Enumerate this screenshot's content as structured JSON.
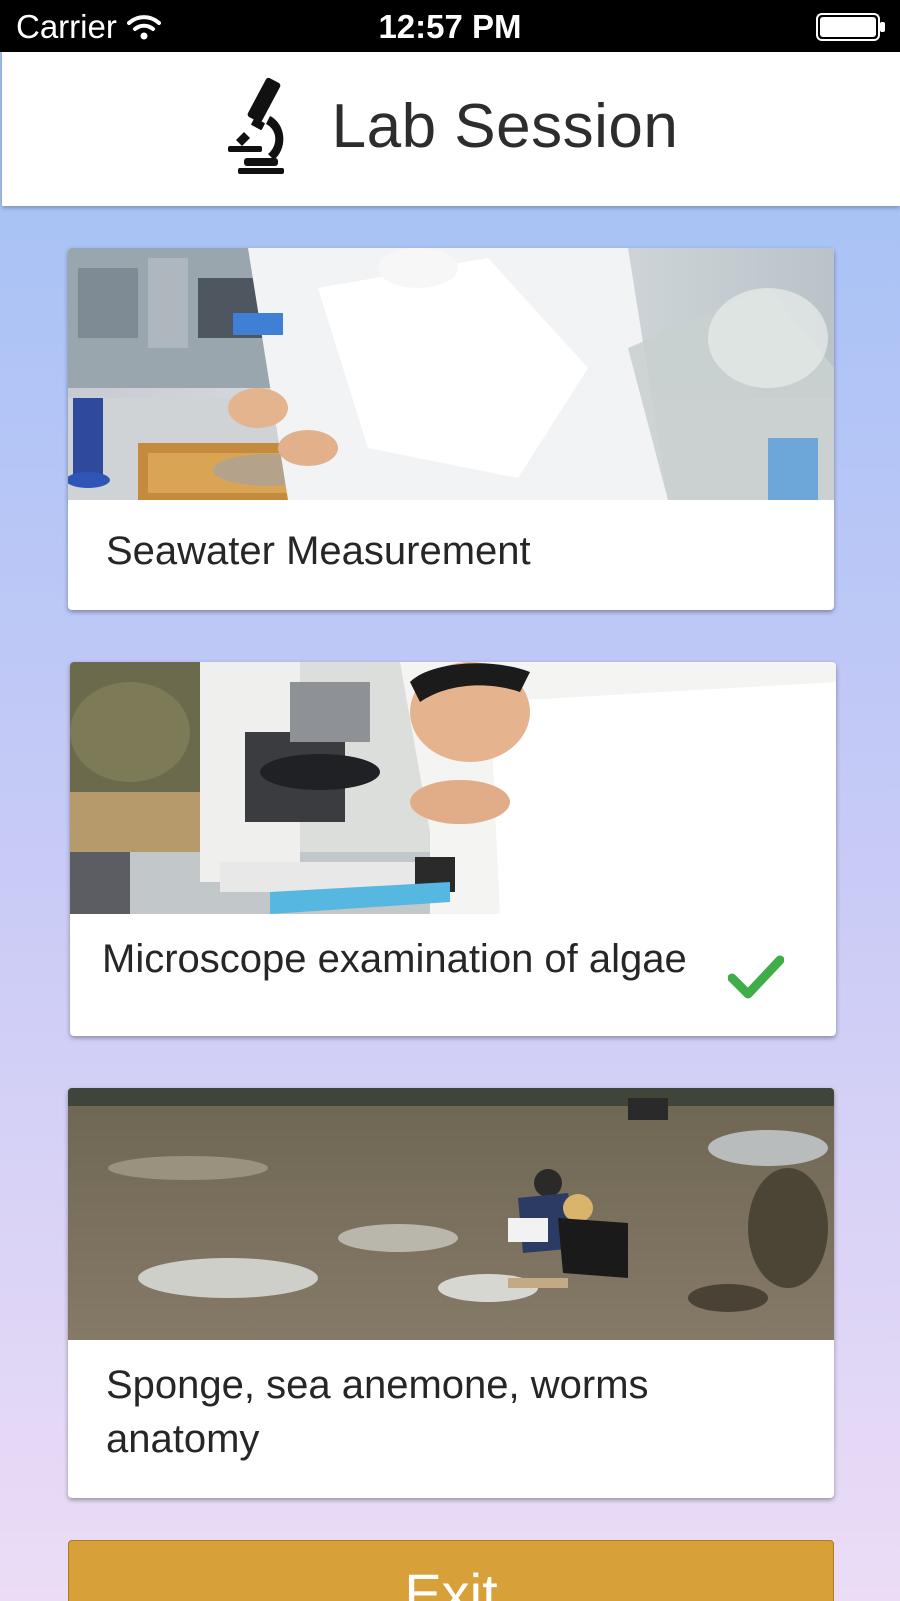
{
  "status_bar": {
    "carrier": "Carrier",
    "time": "12:57 PM",
    "wifi_icon": "wifi-icon",
    "battery_icon": "battery-icon"
  },
  "header": {
    "title": "Lab Session",
    "icon": "microscope-icon"
  },
  "sessions": [
    {
      "label": "Seawater Measurement",
      "image": "lab-dissection-photo",
      "completed": false
    },
    {
      "label": "Microscope examination of algae",
      "image": "microscope-photo",
      "completed": true
    },
    {
      "label": "Sponge, sea anemone, worms anatomy",
      "image": "mudflat-fieldwork-photo",
      "completed": false
    }
  ],
  "exit_button": {
    "label": "Exit"
  },
  "colors": {
    "background_top": "#9fc0f5",
    "background_bottom": "#ecdcf6",
    "exit_button": "#d7a038",
    "check": "#3fae49"
  }
}
